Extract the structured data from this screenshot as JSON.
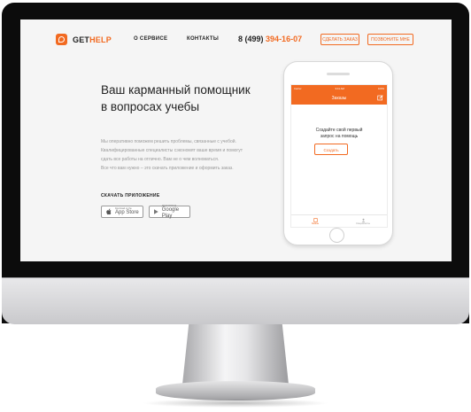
{
  "colors": {
    "accent": "#f26a21",
    "text": "#222222",
    "muted": "#999999",
    "screen_bg": "#f5f5f5"
  },
  "header": {
    "logo_get": "GET",
    "logo_help": "HELP",
    "nav": [
      {
        "label": "О СЕРВИСЕ"
      },
      {
        "label": "КОНТАКТЫ"
      }
    ],
    "phone_prefix": "8 (499)",
    "phone_number": "394-16-07",
    "order_button": "СДЕЛАТЬ ЗАКАЗ",
    "executor_button": "ПОЗВОНИТЕ МНЕ"
  },
  "hero": {
    "title_line1": "Ваш карманный помощник",
    "title_line2": "в вопросах учебы",
    "desc_lines": [
      "Мы оперативно поможем решить проблемы, связанные с учебой.",
      "Квалифицированные специалисты сэкономят ваше время и помогут",
      "сдать все работы на отлично. Вам не о чем волноваться.",
      "Все что вам нужно – это скачать приложение и оформить заказ."
    ],
    "download_label": "СКАЧАТЬ ПРИЛОЖЕНИЕ",
    "appstore_small": "Download on the",
    "appstore_big": "App Store",
    "googleplay_small": "ДОСТУПНО В",
    "googleplay_big": "Google Play"
  },
  "app": {
    "status_carrier": "Carrier",
    "status_time": "9:41 AM",
    "status_battery": "100%",
    "header_title": "Заказы",
    "empty_line1": "Создайте свой первый",
    "empty_line2": "запрос на помощь",
    "create_button": "Создать",
    "tabs": [
      {
        "label": "Заказы"
      },
      {
        "label": "Специалисты"
      }
    ]
  }
}
